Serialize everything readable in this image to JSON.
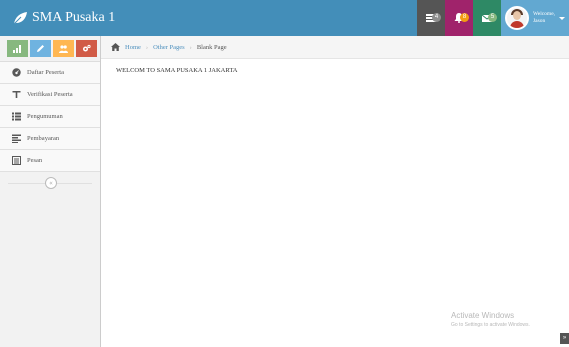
{
  "brand": {
    "title": "SMA Pusaka 1",
    "icon": "leaf-icon"
  },
  "navbar": {
    "tasks": {
      "icon": "tasks-icon",
      "count": "4"
    },
    "notifications": {
      "icon": "bell-icon",
      "count": "8"
    },
    "messages": {
      "icon": "envelope-icon",
      "count": "5"
    },
    "user": {
      "welcome": "Welcome,",
      "name": "Jason",
      "avatar": "user-avatar"
    }
  },
  "shortcuts": [
    {
      "icon": "signal-icon",
      "color": "#87b87f"
    },
    {
      "icon": "pencil-icon",
      "color": "#6fb3e0"
    },
    {
      "icon": "users-icon",
      "color": "#ffb752"
    },
    {
      "icon": "cogs-icon",
      "color": "#d15b47"
    }
  ],
  "sidebar": {
    "items": [
      {
        "label": "Daftar Peserta",
        "icon": "dashboard-icon"
      },
      {
        "label": "Verifikasi Peserta",
        "icon": "text-width-icon"
      },
      {
        "label": "Pengumuman",
        "icon": "list-icon"
      },
      {
        "label": "Pembayaran",
        "icon": "list-alt-icon"
      },
      {
        "label": "Pesan",
        "icon": "calendar-list-icon"
      }
    ],
    "collapse_glyph": "«"
  },
  "breadcrumbs": {
    "home": "Home",
    "parent": "Other Pages",
    "current": "Blank Page",
    "separator": "›"
  },
  "content": {
    "text": "WELCOM TO SAMA PUSAKA 1 JAKARTA"
  },
  "watermark": {
    "title": "Activate Windows",
    "subtitle": "Go to Settings to activate Windows."
  },
  "scroll_top": {
    "glyph": "»"
  }
}
